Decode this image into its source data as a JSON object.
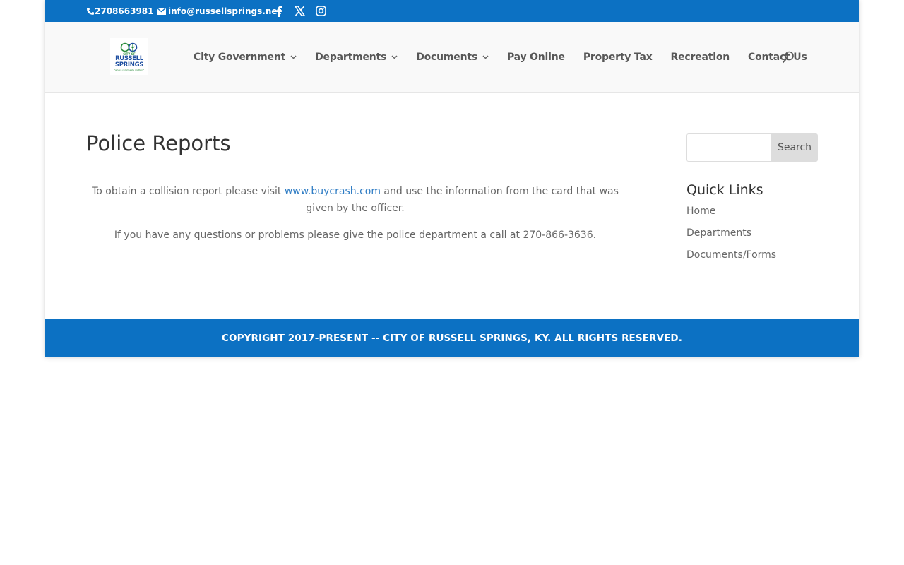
{
  "topbar": {
    "phone": "2708663981",
    "email": "info@russellsprings.net",
    "social": [
      "facebook-icon",
      "x-icon",
      "instagram-icon"
    ]
  },
  "header": {
    "logo": {
      "line1": "CITY OF",
      "line2": "RUSSELL",
      "line3": "SPRINGS",
      "tagline": "\"where community matters\""
    },
    "nav": [
      {
        "label": "City Government",
        "has_dropdown": true
      },
      {
        "label": "Departments",
        "has_dropdown": true
      },
      {
        "label": "Documents",
        "has_dropdown": true
      },
      {
        "label": "Pay Online",
        "has_dropdown": false
      },
      {
        "label": "Property Tax",
        "has_dropdown": false
      },
      {
        "label": "Recreation",
        "has_dropdown": false
      },
      {
        "label": "Contact Us",
        "has_dropdown": false
      }
    ]
  },
  "main": {
    "title": "Police Reports",
    "para1_before": "To obtain a collision report please visit ",
    "para1_link": "www.buycrash.com",
    "para1_after": " and use the information from the card that was given by the officer.",
    "para2": "If you have any questions or problems please give the police department a call at 270-866-3636."
  },
  "sidebar": {
    "search_placeholder": "",
    "search_button": "Search",
    "quick_links_title": "Quick Links",
    "quick_links": [
      "Home",
      "Departments",
      "Documents/Forms"
    ]
  },
  "footer": {
    "copyright": "COPYRIGHT 2017-PRESENT -- CITY OF RUSSELL SPRINGS, KY. ALL RIGHTS RESERVED."
  },
  "colors": {
    "brand_blue": "#0c71c3",
    "link_blue": "#2e7cc4",
    "header_bg": "#f9f9f9"
  }
}
